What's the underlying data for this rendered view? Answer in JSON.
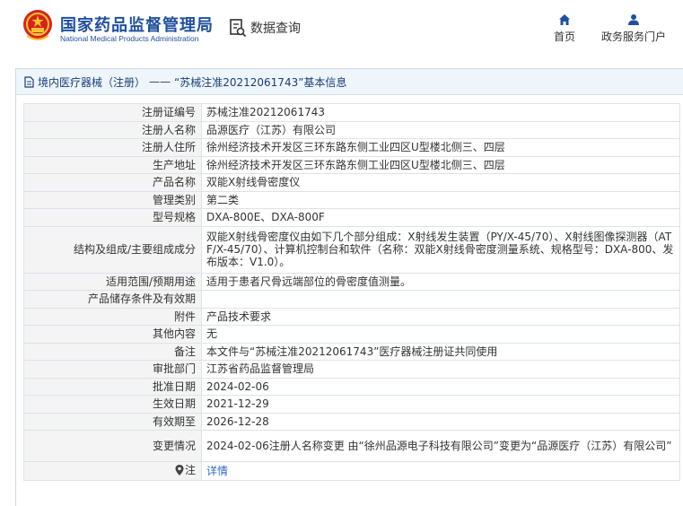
{
  "header": {
    "brand_cn": "国家药品监督管理局",
    "brand_en": "National Medical Products Administration",
    "section_title": "数据查询",
    "nav": [
      {
        "label": "首页",
        "icon": "home-icon"
      },
      {
        "label": "政务服务门户",
        "icon": "user-icon"
      }
    ]
  },
  "breadcrumb": {
    "category": "境内医疗器械（注册）",
    "separator": "——",
    "record_title": "“苏械注准20212061743”基本信息"
  },
  "record": {
    "rows": [
      {
        "key": "注册证编号",
        "value": "苏械注准20212061743"
      },
      {
        "key": "注册人名称",
        "value": "品源医疗（江苏）有限公司"
      },
      {
        "key": "注册人住所",
        "value": "徐州经济技术开发区三环东路东侧工业四区U型楼北侧三、四层"
      },
      {
        "key": "生产地址",
        "value": "徐州经济技术开发区三环东路东侧工业四区U型楼北侧三、四层"
      },
      {
        "key": "产品名称",
        "value": "双能X射线骨密度仪"
      },
      {
        "key": "管理类别",
        "value": "第二类"
      },
      {
        "key": "型号规格",
        "value": "DXA-800E、DXA-800F"
      },
      {
        "key": "结构及组成/主要组成成分",
        "value": "双能X射线骨密度仪由如下几个部分组成：X射线发生装置（PY/X-45/70）、X射线图像探测器（ATF/X-45/70）、计算机控制台和软件（名称：双能X射线骨密度测量系统、规格型号：DXA-800、发布版本：V1.0）。"
      },
      {
        "key": "适用范围/预期用途",
        "value": "适用于患者尺骨远端部位的骨密度值测量。"
      },
      {
        "key": "产品储存条件及有效期",
        "value": ""
      },
      {
        "key": "附件",
        "value": "产品技术要求"
      },
      {
        "key": "其他内容",
        "value": "无"
      },
      {
        "key": "备注",
        "value": "本文件与“苏械注准20212061743”医疗器械注册证共同使用"
      },
      {
        "key": "审批部门",
        "value": "江苏省药品监督管理局"
      },
      {
        "key": "批准日期",
        "value": "2024-02-06"
      },
      {
        "key": "生效日期",
        "value": "2021-12-29"
      },
      {
        "key": "有效期至",
        "value": "2026-12-28"
      },
      {
        "key": "变更情况",
        "value": "2024-02-06注册人名称变更 由“徐州品源电子科技有限公司”变更为“品源医疗（江苏）有限公司”"
      }
    ],
    "note_row": {
      "key": "注",
      "icon": "pin-icon",
      "link_label": "详情"
    }
  },
  "colors": {
    "brand_blue": "#1f4f9f",
    "panel_head_bg": "#eef5fb",
    "key_cell_bg": "#f4f4f4",
    "link_blue": "#2e6cc0"
  }
}
